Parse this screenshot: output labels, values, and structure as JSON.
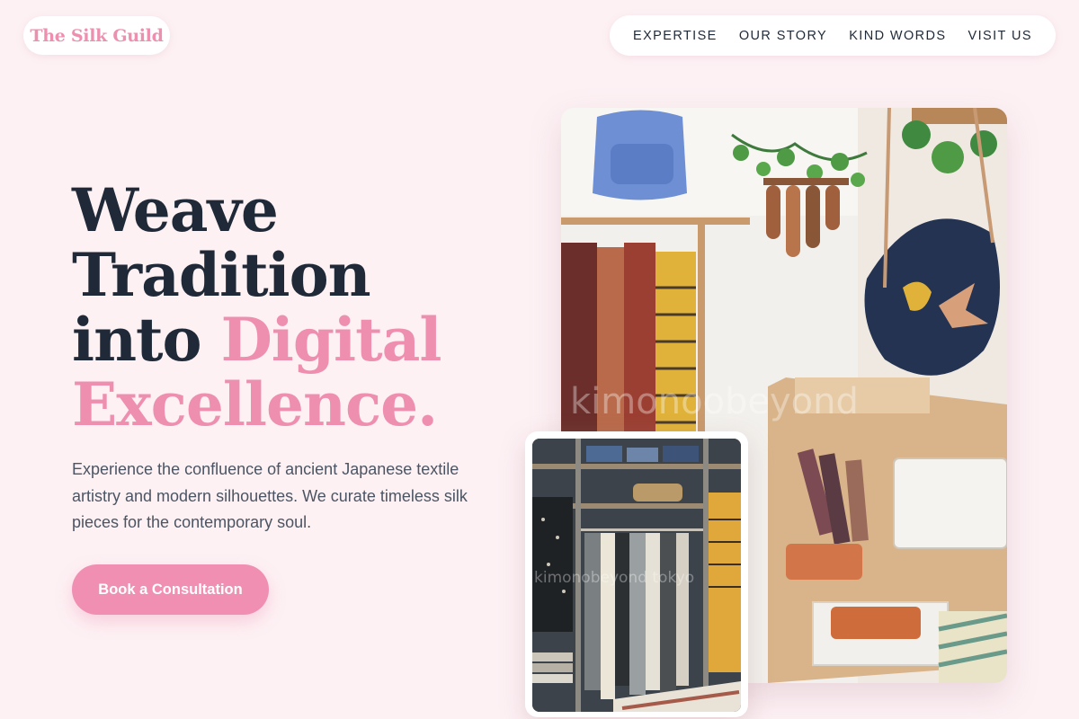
{
  "brand": {
    "name": "The Silk Guild"
  },
  "nav": {
    "items": [
      {
        "label": "EXPERTISE"
      },
      {
        "label": "OUR STORY"
      },
      {
        "label": "KIND WORDS"
      },
      {
        "label": "VISIT US"
      }
    ]
  },
  "hero": {
    "headline_lines": [
      "Weave",
      "Tradition",
      "into",
      "Digital",
      "Excellence."
    ],
    "subtext": "Experience the confluence of ancient Japanese textile artistry and modern silhouettes. We curate timeless silk pieces for the contemporary soul.",
    "cta_label": "Book a Consultation"
  },
  "images": {
    "main_watermark": "kimonoobeyond",
    "inset_watermark": "kimonobeyond tokyo"
  },
  "colors": {
    "accent": "#ee8fb0",
    "button": "#f08fb2",
    "background": "#fdf1f4",
    "text_dark": "#1f2937"
  }
}
